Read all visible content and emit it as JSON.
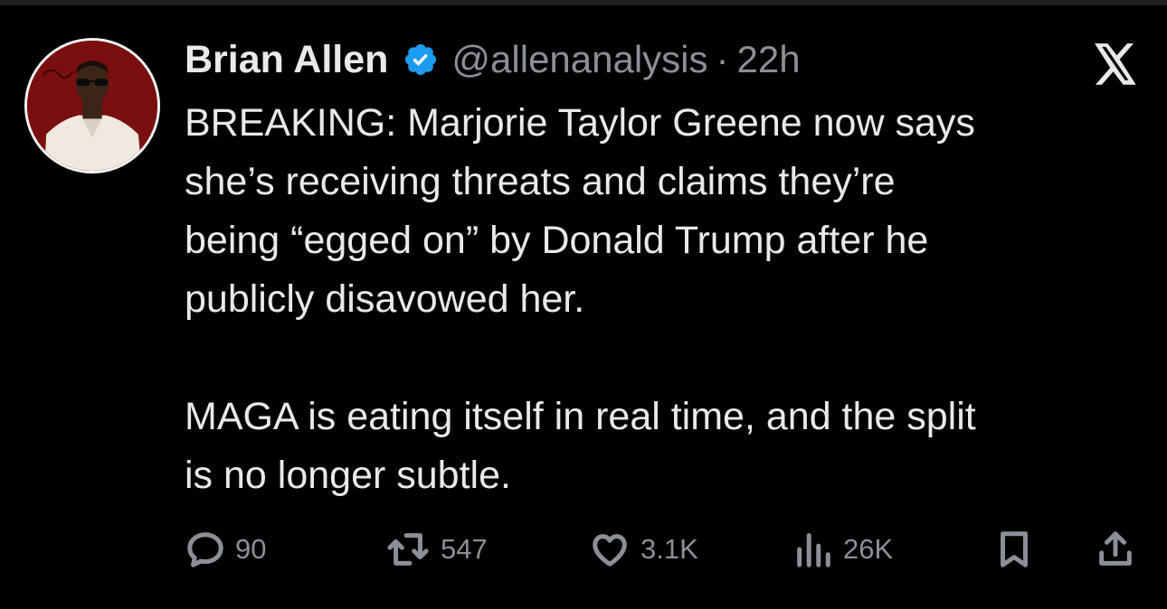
{
  "tweet": {
    "author_name": "Brian Allen",
    "handle": "@allenanalysis",
    "separator": "·",
    "time": "22h",
    "paragraphs": [
      [
        "BREAKING: Marjorie Taylor Greene now says",
        "she’s receiving threats and claims they’re",
        "being “egged on” by Donald Trump after he",
        "publicly disavowed her."
      ],
      [
        "MAGA is eating itself in real time, and the split",
        "is no longer subtle."
      ]
    ]
  },
  "actions": {
    "replies": "90",
    "reposts": "547",
    "likes": "3.1K",
    "views": "26K"
  },
  "icons": {
    "verified": "verified-badge-icon",
    "brand": "x-logo-icon",
    "reply": "reply-icon",
    "repost": "repost-icon",
    "like": "heart-icon",
    "views": "views-icon",
    "bookmark": "bookmark-icon",
    "share": "share-icon"
  },
  "colors": {
    "background": "#000000",
    "text": "#e7e9ea",
    "muted": "#8b9098",
    "verified": "#1d9bf0"
  }
}
